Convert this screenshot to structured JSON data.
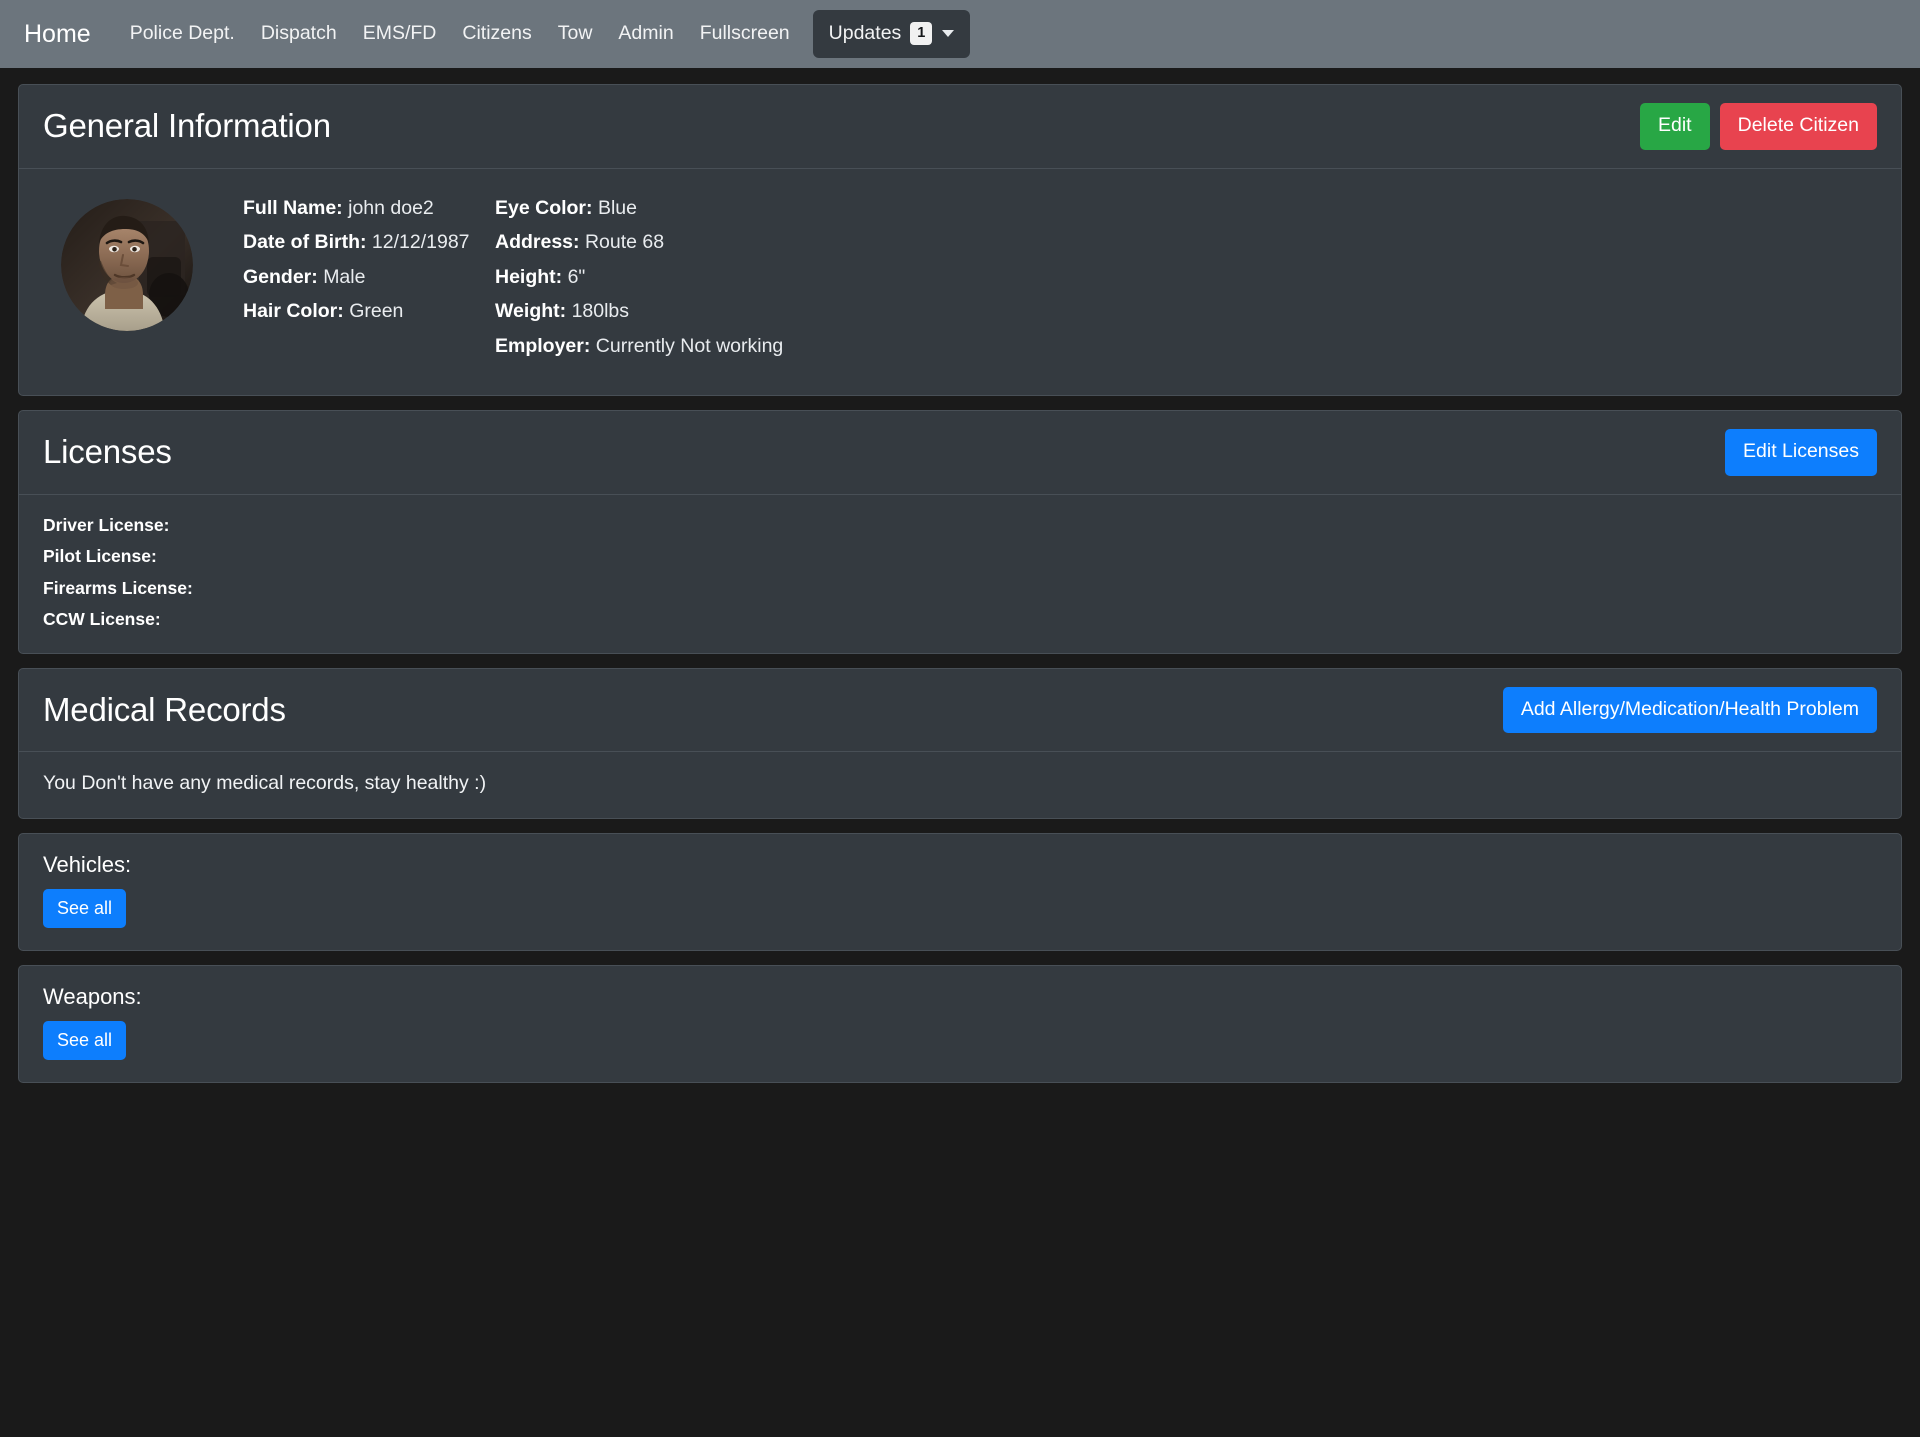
{
  "navbar": {
    "brand": "Home",
    "links": [
      {
        "label": "Police Dept."
      },
      {
        "label": "Dispatch"
      },
      {
        "label": "EMS/FD"
      },
      {
        "label": "Citizens"
      },
      {
        "label": "Tow"
      },
      {
        "label": "Admin"
      },
      {
        "label": "Fullscreen"
      }
    ],
    "dropdown": {
      "label": "Updates",
      "badge": "1",
      "caret_icon": "chevron-down-icon"
    },
    "background_color": "#6c757d"
  },
  "general_information": {
    "title": "General Information",
    "edit_label": "Edit",
    "delete_label": "Delete Citizen",
    "edit_color": "#28a745",
    "delete_color": "#e8434f",
    "avatar_alt": "citizen-portrait",
    "left_fields": [
      {
        "label": "Full Name:",
        "value": "john doe2"
      },
      {
        "label": "Date of Birth:",
        "value": "12/12/1987"
      },
      {
        "label": "Gender:",
        "value": "Male"
      },
      {
        "label": "Hair Color:",
        "value": "Green"
      }
    ],
    "right_fields": [
      {
        "label": "Eye Color:",
        "value": "Blue"
      },
      {
        "label": "Address:",
        "value": "Route 68"
      },
      {
        "label": "Height:",
        "value": "6\""
      },
      {
        "label": "Weight:",
        "value": "180lbs"
      },
      {
        "label": "Employer:",
        "value": "Currently Not working"
      }
    ]
  },
  "licenses": {
    "title": "Licenses",
    "edit_label": "Edit Licenses",
    "button_color": "#0d7efd",
    "items": [
      {
        "label": "Driver License:",
        "value": ""
      },
      {
        "label": "Pilot License:",
        "value": ""
      },
      {
        "label": "Firearms License:",
        "value": ""
      },
      {
        "label": "CCW License:",
        "value": ""
      }
    ]
  },
  "medical_records": {
    "title": "Medical Records",
    "add_label": "Add Allergy/Medication/Health Problem",
    "button_color": "#0d7efd",
    "empty_text": "You Don't have any medical records, stay healthy :)"
  },
  "vehicles": {
    "title": "Vehicles:",
    "see_all_label": "See all"
  },
  "weapons": {
    "title": "Weapons:",
    "see_all_label": "See all"
  }
}
